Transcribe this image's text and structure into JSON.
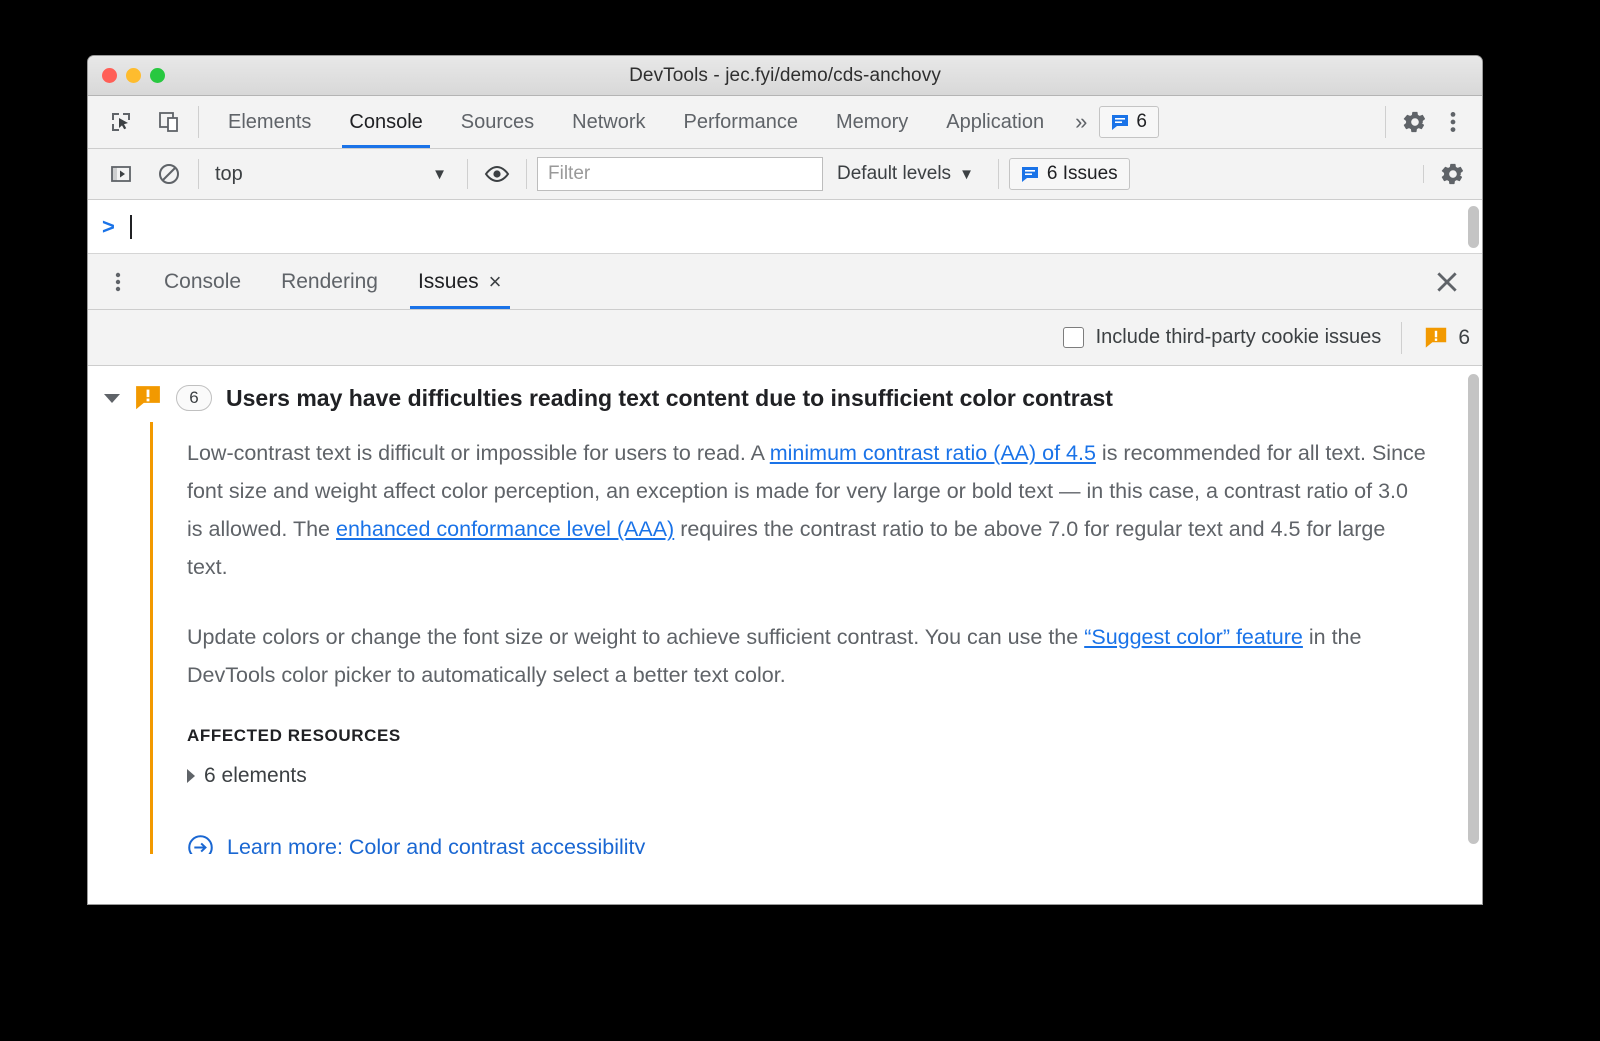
{
  "window": {
    "title": "DevTools - jec.fyi/demo/cds-anchovy",
    "traffic_lights": [
      "close",
      "minimize",
      "zoom"
    ]
  },
  "main_toolbar": {
    "icons": [
      "inspect-element-icon",
      "device-toolbar-icon"
    ],
    "tabs": [
      {
        "label": "Elements",
        "active": false
      },
      {
        "label": "Console",
        "active": true
      },
      {
        "label": "Sources",
        "active": false
      },
      {
        "label": "Network",
        "active": false
      },
      {
        "label": "Performance",
        "active": false
      },
      {
        "label": "Memory",
        "active": false
      },
      {
        "label": "Application",
        "active": false
      }
    ],
    "more_tabs_label": "»",
    "issues_badge_count": "6",
    "settings_icon": "gear-icon",
    "menu_icon": "kebab-icon"
  },
  "console_toolbar": {
    "sidebar_toggle_icon": "console-sidebar-icon",
    "clear_icon": "clear-console-icon",
    "context": "top",
    "context_caret": "▼",
    "eye_icon": "live-expression-icon",
    "filter_placeholder": "Filter",
    "filter_value": "",
    "levels_label": "Default levels",
    "levels_caret": "▼",
    "issues_button_label": "6 Issues",
    "settings_icon": "gear-icon"
  },
  "console_prompt": {
    "prompt_symbol": ">",
    "input_value": ""
  },
  "drawer": {
    "menu_icon": "kebab-icon",
    "tabs": [
      {
        "label": "Console",
        "active": false,
        "closable": false
      },
      {
        "label": "Rendering",
        "active": false,
        "closable": false
      },
      {
        "label": "Issues",
        "active": true,
        "closable": true
      }
    ],
    "close_icon": "close-icon",
    "close_label": "×"
  },
  "issues_toolbar": {
    "third_party_checkbox_label": "Include third-party cookie issues",
    "third_party_checked": false,
    "warning_icon": "warning-bubble-icon",
    "warning_count": "6"
  },
  "issue": {
    "expanded": true,
    "expand_icon": "triangle-down-icon",
    "severity_icon": "warning-bubble-icon",
    "count": "6",
    "title": "Users may have difficulties reading text content due to insufficient color contrast",
    "paragraph_1": {
      "part_1": "Low-contrast text is difficult or impossible for users to read. A ",
      "link_1": "minimum contrast ratio (AA) of 4.5",
      "part_2": " is recommended for all text. Since font size and weight affect color perception, an exception is made for very large or bold text — in this case, a contrast ratio of 3.0 is allowed. The ",
      "link_2": "enhanced conformance level (AAA)",
      "part_3": " requires the contrast ratio to be above 7.0 for regular text and 4.5 for large text."
    },
    "paragraph_2": {
      "part_1": "Update colors or change the font size or weight to achieve sufficient contrast. You can use the ",
      "link_1": "“Suggest color” feature",
      "part_2": " in the DevTools color picker to automatically select a better text color."
    },
    "affected_resources_heading": "AFFECTED RESOURCES",
    "affected_resources_item": "6 elements",
    "affected_resources_icon": "triangle-right-icon",
    "learn_more_icon": "external-link-circle-icon",
    "learn_more_label": "Learn more: Color and contrast accessibility"
  },
  "colors": {
    "accent_blue": "#1a73e8",
    "link_blue": "#1a67d2",
    "warning_orange": "#f29900",
    "text_primary": "#202124",
    "text_secondary": "#5f6368",
    "toolbar_bg": "#f3f3f3"
  }
}
